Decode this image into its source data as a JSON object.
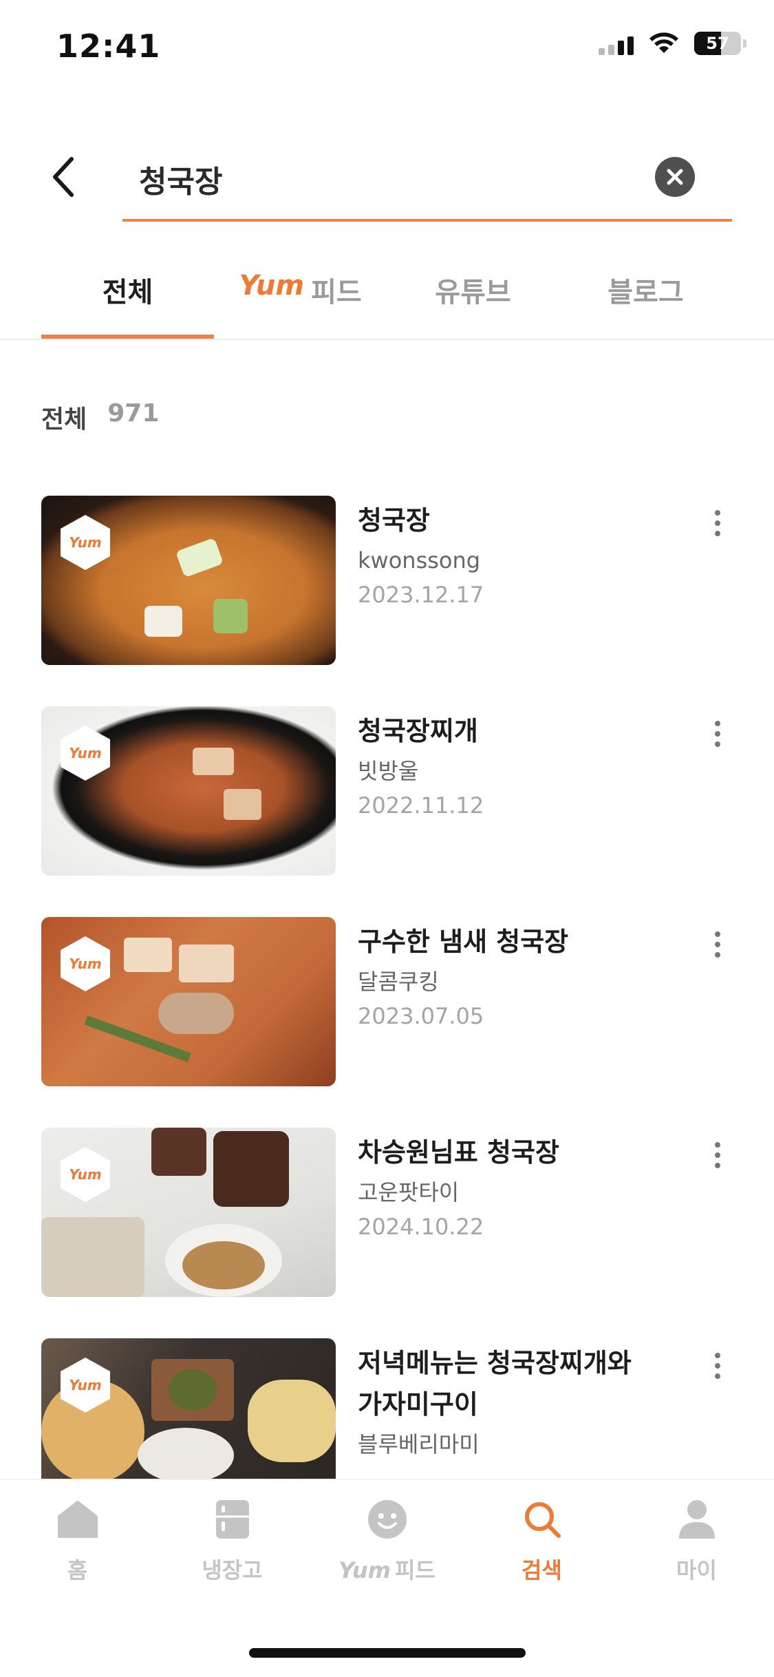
{
  "status_bar": {
    "time": "12:41",
    "battery": "57",
    "battery_level": 0.57
  },
  "search": {
    "query": "청국장"
  },
  "tabs": [
    {
      "yum": "",
      "label": "전체"
    },
    {
      "yum": "Yum",
      "label": "피드"
    },
    {
      "yum": "",
      "label": "유튜브"
    },
    {
      "yum": "",
      "label": "블로그"
    }
  ],
  "results_summary": {
    "label": "전체",
    "count": "971"
  },
  "badge_text": "Yum",
  "results": [
    {
      "title": "청국장",
      "author": "kwonssong",
      "date": "2023.12.17"
    },
    {
      "title": "청국장찌개",
      "author": "빗방울",
      "date": "2022.11.12"
    },
    {
      "title": "구수한 냄새 청국장",
      "author": "달콤쿠킹",
      "date": "2023.07.05"
    },
    {
      "title": "차승원님표 청국장",
      "author": "고운팟타이",
      "date": "2024.10.22"
    },
    {
      "title": "저녁메뉴는 청국장찌개와",
      "title_line2": "가자미구이",
      "author": "블루베리마미",
      "date": ""
    }
  ],
  "bottom_nav": [
    {
      "yum": "",
      "label": "홈",
      "icon": "home-icon"
    },
    {
      "yum": "",
      "label": "냉장고",
      "icon": "fridge-icon"
    },
    {
      "yum": "Yum",
      "label": "피드",
      "icon": "smile-icon"
    },
    {
      "yum": "",
      "label": "검색",
      "icon": "search-icon"
    },
    {
      "yum": "",
      "label": "마이",
      "icon": "person-icon"
    }
  ],
  "colors": {
    "accent": "#ee7a33",
    "underline": "#e9834a",
    "inactive": "#c4c4c4"
  }
}
